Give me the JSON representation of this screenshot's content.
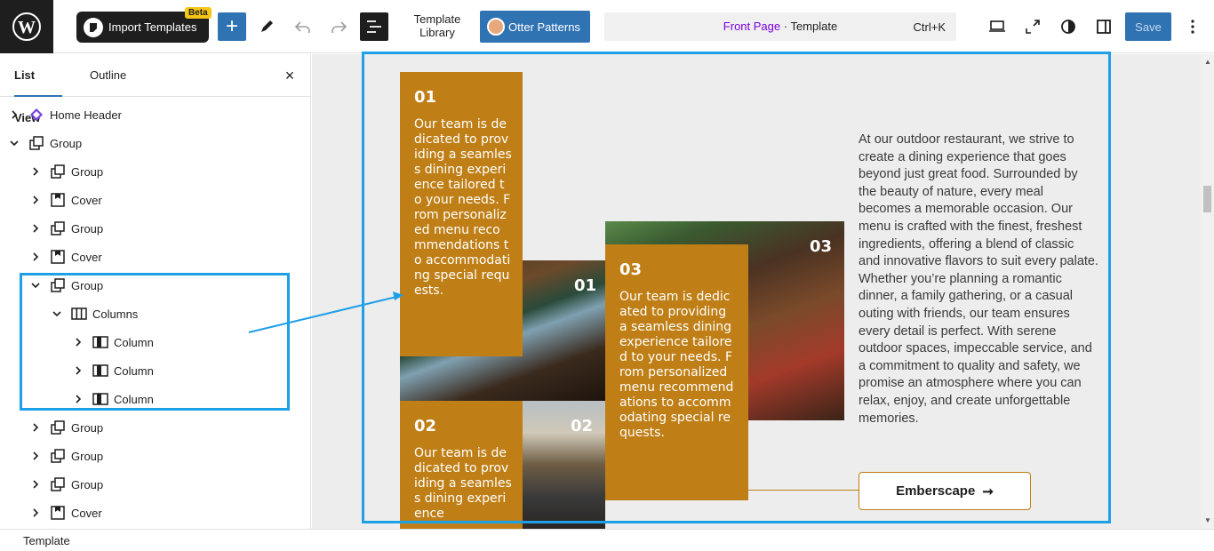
{
  "toolbar": {
    "import_label": "Import Templates",
    "beta": "Beta",
    "template_library_line1": "Template",
    "template_library_line2": "Library",
    "otter_label": "Otter Patterns",
    "doc_page": "Front Page",
    "doc_sep": " · Template",
    "shortcut": "Ctrl+K",
    "save_label": "Save"
  },
  "sidebar": {
    "tab_list": "List View",
    "tab_outline": "Outline",
    "items": [
      {
        "label": "Home Header",
        "icon": "pattern-icon",
        "expanded": false
      },
      {
        "label": "Group",
        "icon": "group-icon",
        "expanded": true
      },
      {
        "label": "Group",
        "icon": "group-icon",
        "expanded": false
      },
      {
        "label": "Cover",
        "icon": "cover-icon",
        "expanded": false
      },
      {
        "label": "Group",
        "icon": "group-icon",
        "expanded": false
      },
      {
        "label": "Cover",
        "icon": "cover-icon",
        "expanded": false
      },
      {
        "label": "Group",
        "icon": "group-icon",
        "expanded": true
      },
      {
        "label": "Columns",
        "icon": "columns-icon",
        "expanded": true
      },
      {
        "label": "Column",
        "icon": "column-icon",
        "expanded": false
      },
      {
        "label": "Column",
        "icon": "column-icon",
        "expanded": false
      },
      {
        "label": "Column",
        "icon": "column-icon",
        "expanded": false
      },
      {
        "label": "Group",
        "icon": "group-icon",
        "expanded": false
      },
      {
        "label": "Group",
        "icon": "group-icon",
        "expanded": false
      },
      {
        "label": "Group",
        "icon": "group-icon",
        "expanded": false
      },
      {
        "label": "Cover",
        "icon": "cover-icon",
        "expanded": false
      }
    ]
  },
  "canvas": {
    "card1": {
      "num": "01",
      "text": "Our team is dedicated to providing a seamless dining experience tailored to your needs. From personalized menu recommendations to accommodating special requests."
    },
    "card2": {
      "num": "02",
      "text": "Our team is dedicated to providing a seamless dining experience"
    },
    "card3": {
      "num": "03",
      "text": "Our team is dedicated to providing a seamless dining experience tailored to your needs. From personalized menu recommendations to accommodating special requests."
    },
    "photo1_num": "01",
    "photo2_num": "02",
    "photo3_num": "03",
    "paragraph": "At our outdoor restaurant, we strive to create a dining experience that goes beyond just great food. Surrounded by the beauty of nature, every meal becomes a memorable occasion. Our menu is crafted with the finest, freshest ingredients, offering a blend of classic and innovative flavors to suit every palate. Whether you’re planning a romantic dinner, a family gathering, or a casual outing with friends, our team ensures every detail is perfect. With serene outdoor spaces, impeccable service, and a commitment to quality and safety, we promise an atmosphere where you can relax, enjoy, and create unforgettable memories.",
    "button_label": "Emberscape",
    "button_arrow": "➞"
  },
  "footer": {
    "breadcrumb": "Template"
  },
  "colors": {
    "accent": "#3073b3",
    "card": "#bf7f16",
    "highlight": "#1ea0e8",
    "ink": "#1e1e1e"
  }
}
